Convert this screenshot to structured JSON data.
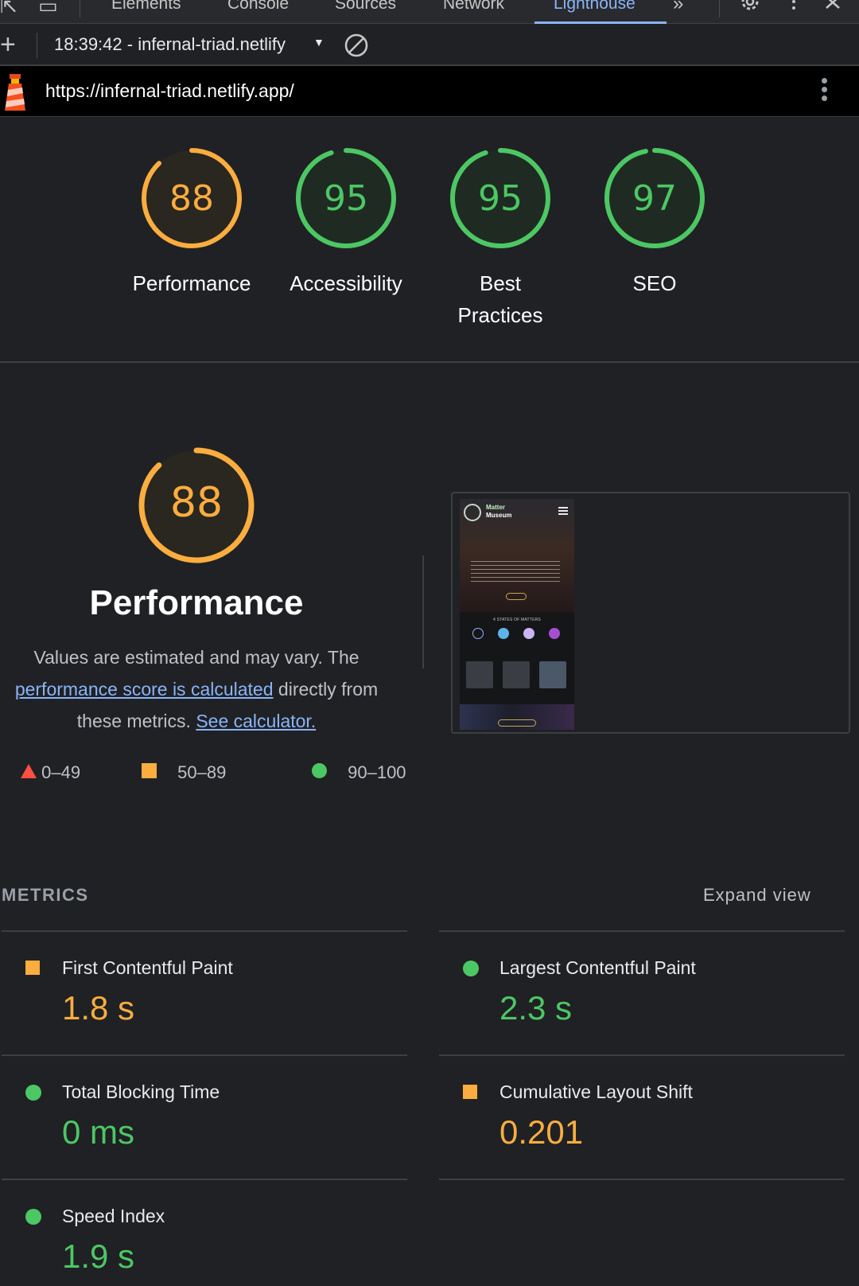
{
  "devtools": {
    "tabs": [
      "Elements",
      "Console",
      "Sources",
      "Network",
      "Lighthouse"
    ],
    "active_tab": "Lighthouse",
    "overflow_icon": "chevron-double-right-icon",
    "settings_icon": "gear-icon",
    "more_icon": "more-vertical-icon",
    "close_icon": "close-icon"
  },
  "lighthouse_toolbar": {
    "report_label": "18:39:42 - infernal-triad.netlify",
    "add_icon": "plus-icon",
    "clear_icon": "block-icon"
  },
  "urlbar": {
    "url": "https://infernal-triad.netlify.app/"
  },
  "colors": {
    "average": "#fbad3f",
    "pass": "#4cc764",
    "fail": "#ff4e42",
    "link": "#8ab4f8"
  },
  "gauges": [
    {
      "score": "88",
      "label": "Performance",
      "status": "average"
    },
    {
      "score": "95",
      "label": "Accessibility",
      "status": "pass"
    },
    {
      "score": "95",
      "label": "Best Practices",
      "status": "pass"
    },
    {
      "score": "97",
      "label": "SEO",
      "status": "pass"
    }
  ],
  "performance": {
    "score": "88",
    "title": "Performance",
    "desc_prefix": "Values are estimated and may vary. The",
    "desc_link": "performance score is calculated",
    "desc_middle": "directly from these metrics.",
    "desc_calc_link": "See calculator.",
    "legend": {
      "fail": "0–49",
      "average": "50–89",
      "pass": "90–100"
    }
  },
  "screenshot": {
    "brand_line1": "Matter",
    "brand_line2": "Museum",
    "states_title": "4 STATES OF MATTERS",
    "hero_button": "Explore",
    "banner_button": "Explore matters"
  },
  "metrics": {
    "heading": "METRICS",
    "expand_label": "Expand view",
    "items": [
      {
        "label": "First Contentful Paint",
        "value": "1.8 s",
        "status": "average"
      },
      {
        "label": "Largest Contentful Paint",
        "value": "2.3 s",
        "status": "pass"
      },
      {
        "label": "Total Blocking Time",
        "value": "0 ms",
        "status": "pass"
      },
      {
        "label": "Cumulative Layout Shift",
        "value": "0.201",
        "status": "average"
      },
      {
        "label": "Speed Index",
        "value": "1.9 s",
        "status": "pass"
      }
    ]
  }
}
